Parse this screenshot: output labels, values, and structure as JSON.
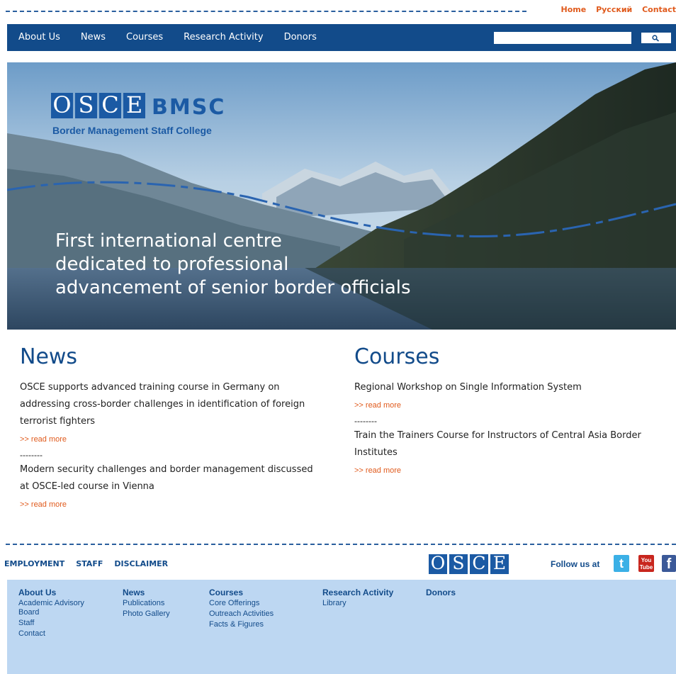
{
  "top_links": [
    "Home",
    "Русский",
    "Contact"
  ],
  "nav": [
    "About Us",
    "News",
    "Courses",
    "Research Activity",
    "Donors"
  ],
  "search": {
    "placeholder": ""
  },
  "logo": {
    "letters": [
      "O",
      "S",
      "C",
      "E"
    ],
    "bmsc": "BMSC",
    "subtitle": "Border Management Staff College"
  },
  "hero": {
    "line1": "First international centre",
    "line2": "dedicated to professional",
    "line3": "advancement of senior border officials"
  },
  "news": {
    "heading": "News",
    "items": [
      {
        "text": "OSCE supports advanced training course in Germany on addressing cross-border challenges in identification of foreign terrorist fighters",
        "more": ">> read more"
      },
      {
        "text": "Modern security challenges and border management discussed at OSCE-led course in Vienna",
        "more": ">> read more"
      }
    ],
    "separator": "--------"
  },
  "courses": {
    "heading": "Courses",
    "items": [
      {
        "text": "Regional Workshop on Single Information System",
        "more": ">> read more"
      },
      {
        "text": "Train the Trainers Course for Instructors of Central Asia Border Institutes",
        "more": ">> read more"
      }
    ],
    "separator": "--------"
  },
  "footer_links": [
    "EMPLOYMENT",
    "STAFF",
    "DISCLAIMER"
  ],
  "footer_logo": [
    "O",
    "S",
    "C",
    "E"
  ],
  "follow": "Follow us at",
  "social": {
    "twitter": "t",
    "youtube_top": "You",
    "youtube_bottom": "Tube",
    "facebook": "f"
  },
  "footer_nav": {
    "about": {
      "title": "About Us",
      "items": [
        "Academic Advisory Board",
        "Staff",
        "Contact"
      ]
    },
    "news": {
      "title": "News",
      "items": [
        "Publications",
        "Photo Gallery"
      ]
    },
    "courses": {
      "title": "Courses",
      "items": [
        "Core Offerings",
        "Outreach Activities",
        "Facts & Figures"
      ]
    },
    "research": {
      "title": "Research Activity",
      "items": [
        "Library"
      ]
    },
    "donors": {
      "title": "Donors",
      "items": []
    }
  },
  "colors": {
    "brand_blue": "#124b8a",
    "accent_orange": "#e05a1c",
    "footer_bg": "#bdd7f2"
  }
}
